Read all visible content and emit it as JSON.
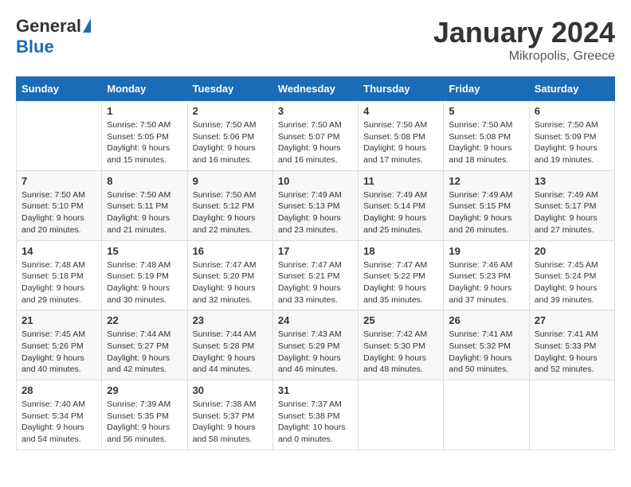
{
  "header": {
    "logo_general": "General",
    "logo_blue": "Blue",
    "month_title": "January 2024",
    "location": "Mikropolis, Greece"
  },
  "days_of_week": [
    "Sunday",
    "Monday",
    "Tuesday",
    "Wednesday",
    "Thursday",
    "Friday",
    "Saturday"
  ],
  "weeks": [
    [
      {
        "day": "",
        "sunrise": "",
        "sunset": "",
        "daylight": ""
      },
      {
        "day": "1",
        "sunrise": "Sunrise: 7:50 AM",
        "sunset": "Sunset: 5:05 PM",
        "daylight": "Daylight: 9 hours and 15 minutes."
      },
      {
        "day": "2",
        "sunrise": "Sunrise: 7:50 AM",
        "sunset": "Sunset: 5:06 PM",
        "daylight": "Daylight: 9 hours and 16 minutes."
      },
      {
        "day": "3",
        "sunrise": "Sunrise: 7:50 AM",
        "sunset": "Sunset: 5:07 PM",
        "daylight": "Daylight: 9 hours and 16 minutes."
      },
      {
        "day": "4",
        "sunrise": "Sunrise: 7:50 AM",
        "sunset": "Sunset: 5:08 PM",
        "daylight": "Daylight: 9 hours and 17 minutes."
      },
      {
        "day": "5",
        "sunrise": "Sunrise: 7:50 AM",
        "sunset": "Sunset: 5:08 PM",
        "daylight": "Daylight: 9 hours and 18 minutes."
      },
      {
        "day": "6",
        "sunrise": "Sunrise: 7:50 AM",
        "sunset": "Sunset: 5:09 PM",
        "daylight": "Daylight: 9 hours and 19 minutes."
      }
    ],
    [
      {
        "day": "7",
        "sunrise": "Sunrise: 7:50 AM",
        "sunset": "Sunset: 5:10 PM",
        "daylight": "Daylight: 9 hours and 20 minutes."
      },
      {
        "day": "8",
        "sunrise": "Sunrise: 7:50 AM",
        "sunset": "Sunset: 5:11 PM",
        "daylight": "Daylight: 9 hours and 21 minutes."
      },
      {
        "day": "9",
        "sunrise": "Sunrise: 7:50 AM",
        "sunset": "Sunset: 5:12 PM",
        "daylight": "Daylight: 9 hours and 22 minutes."
      },
      {
        "day": "10",
        "sunrise": "Sunrise: 7:49 AM",
        "sunset": "Sunset: 5:13 PM",
        "daylight": "Daylight: 9 hours and 23 minutes."
      },
      {
        "day": "11",
        "sunrise": "Sunrise: 7:49 AM",
        "sunset": "Sunset: 5:14 PM",
        "daylight": "Daylight: 9 hours and 25 minutes."
      },
      {
        "day": "12",
        "sunrise": "Sunrise: 7:49 AM",
        "sunset": "Sunset: 5:15 PM",
        "daylight": "Daylight: 9 hours and 26 minutes."
      },
      {
        "day": "13",
        "sunrise": "Sunrise: 7:49 AM",
        "sunset": "Sunset: 5:17 PM",
        "daylight": "Daylight: 9 hours and 27 minutes."
      }
    ],
    [
      {
        "day": "14",
        "sunrise": "Sunrise: 7:48 AM",
        "sunset": "Sunset: 5:18 PM",
        "daylight": "Daylight: 9 hours and 29 minutes."
      },
      {
        "day": "15",
        "sunrise": "Sunrise: 7:48 AM",
        "sunset": "Sunset: 5:19 PM",
        "daylight": "Daylight: 9 hours and 30 minutes."
      },
      {
        "day": "16",
        "sunrise": "Sunrise: 7:47 AM",
        "sunset": "Sunset: 5:20 PM",
        "daylight": "Daylight: 9 hours and 32 minutes."
      },
      {
        "day": "17",
        "sunrise": "Sunrise: 7:47 AM",
        "sunset": "Sunset: 5:21 PM",
        "daylight": "Daylight: 9 hours and 33 minutes."
      },
      {
        "day": "18",
        "sunrise": "Sunrise: 7:47 AM",
        "sunset": "Sunset: 5:22 PM",
        "daylight": "Daylight: 9 hours and 35 minutes."
      },
      {
        "day": "19",
        "sunrise": "Sunrise: 7:46 AM",
        "sunset": "Sunset: 5:23 PM",
        "daylight": "Daylight: 9 hours and 37 minutes."
      },
      {
        "day": "20",
        "sunrise": "Sunrise: 7:45 AM",
        "sunset": "Sunset: 5:24 PM",
        "daylight": "Daylight: 9 hours and 39 minutes."
      }
    ],
    [
      {
        "day": "21",
        "sunrise": "Sunrise: 7:45 AM",
        "sunset": "Sunset: 5:26 PM",
        "daylight": "Daylight: 9 hours and 40 minutes."
      },
      {
        "day": "22",
        "sunrise": "Sunrise: 7:44 AM",
        "sunset": "Sunset: 5:27 PM",
        "daylight": "Daylight: 9 hours and 42 minutes."
      },
      {
        "day": "23",
        "sunrise": "Sunrise: 7:44 AM",
        "sunset": "Sunset: 5:28 PM",
        "daylight": "Daylight: 9 hours and 44 minutes."
      },
      {
        "day": "24",
        "sunrise": "Sunrise: 7:43 AM",
        "sunset": "Sunset: 5:29 PM",
        "daylight": "Daylight: 9 hours and 46 minutes."
      },
      {
        "day": "25",
        "sunrise": "Sunrise: 7:42 AM",
        "sunset": "Sunset: 5:30 PM",
        "daylight": "Daylight: 9 hours and 48 minutes."
      },
      {
        "day": "26",
        "sunrise": "Sunrise: 7:41 AM",
        "sunset": "Sunset: 5:32 PM",
        "daylight": "Daylight: 9 hours and 50 minutes."
      },
      {
        "day": "27",
        "sunrise": "Sunrise: 7:41 AM",
        "sunset": "Sunset: 5:33 PM",
        "daylight": "Daylight: 9 hours and 52 minutes."
      }
    ],
    [
      {
        "day": "28",
        "sunrise": "Sunrise: 7:40 AM",
        "sunset": "Sunset: 5:34 PM",
        "daylight": "Daylight: 9 hours and 54 minutes."
      },
      {
        "day": "29",
        "sunrise": "Sunrise: 7:39 AM",
        "sunset": "Sunset: 5:35 PM",
        "daylight": "Daylight: 9 hours and 56 minutes."
      },
      {
        "day": "30",
        "sunrise": "Sunrise: 7:38 AM",
        "sunset": "Sunset: 5:37 PM",
        "daylight": "Daylight: 9 hours and 58 minutes."
      },
      {
        "day": "31",
        "sunrise": "Sunrise: 7:37 AM",
        "sunset": "Sunset: 5:38 PM",
        "daylight": "Daylight: 10 hours and 0 minutes."
      },
      {
        "day": "",
        "sunrise": "",
        "sunset": "",
        "daylight": ""
      },
      {
        "day": "",
        "sunrise": "",
        "sunset": "",
        "daylight": ""
      },
      {
        "day": "",
        "sunrise": "",
        "sunset": "",
        "daylight": ""
      }
    ]
  ]
}
